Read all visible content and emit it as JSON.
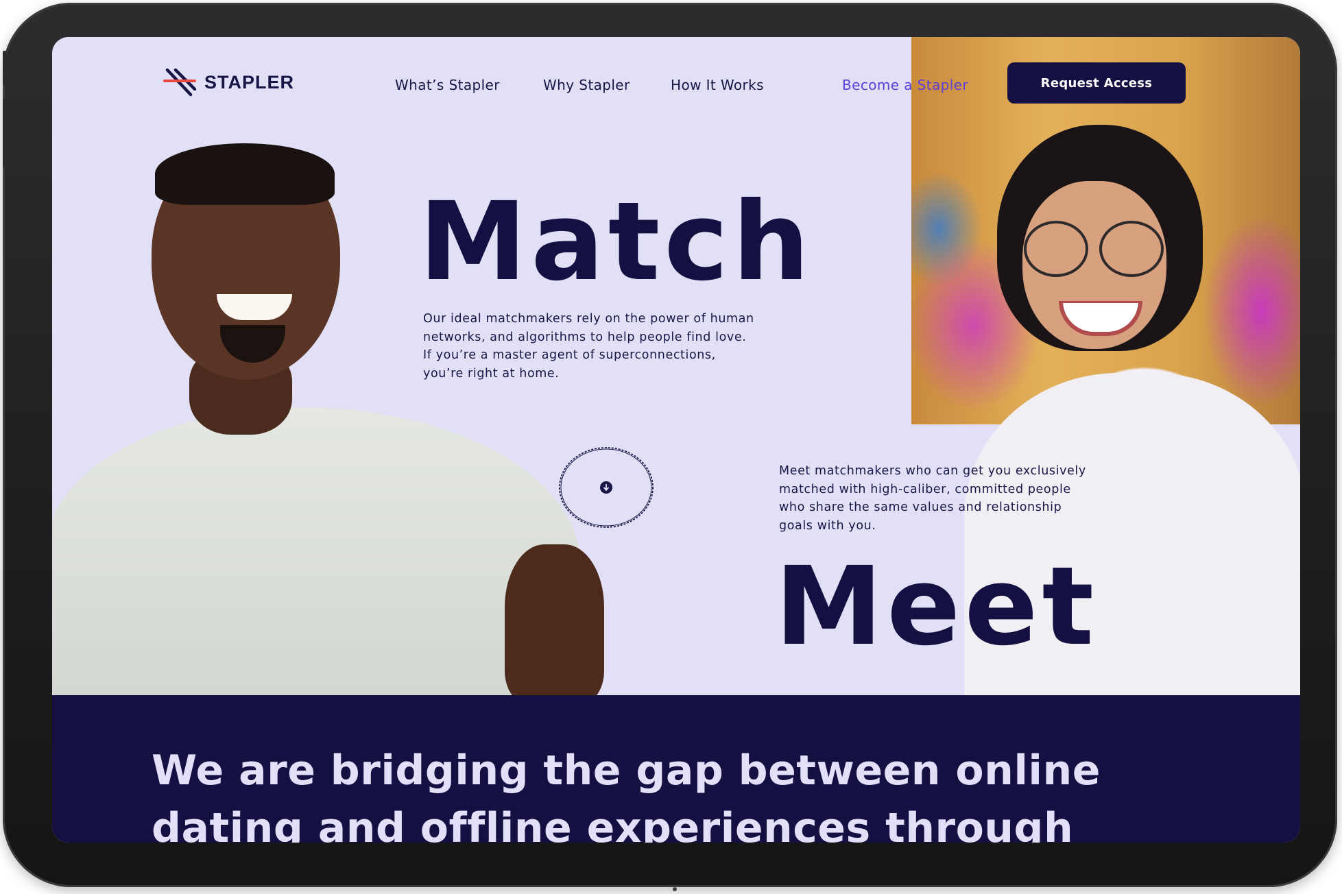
{
  "brand": {
    "name": "STAPLER"
  },
  "nav": {
    "links": [
      "What’s Stapler",
      "Why Stapler",
      "How It Works"
    ],
    "become_label": "Become a Stapler",
    "cta_label": "Request Access"
  },
  "hero": {
    "headline_top": "Match",
    "paragraph_top": "Our ideal matchmakers rely on the power of human networks, and algorithms to help people find love. If you’re a master agent of superconnections, you’re right at home.",
    "paragraph_bottom": "Meet matchmakers who can get you exclusively matched with high-caliber, committed people who share the same values and relationship goals with you.",
    "headline_bottom": "Meet",
    "scroll_icon": "arrow-down-icon"
  },
  "band": {
    "text": "We are bridging the gap between online dating and offline experiences through"
  },
  "colors": {
    "hero_bg": "#e2e0f6",
    "navy": "#151042",
    "accent_purple": "#5b3fd6",
    "logo_red": "#e8473f"
  }
}
